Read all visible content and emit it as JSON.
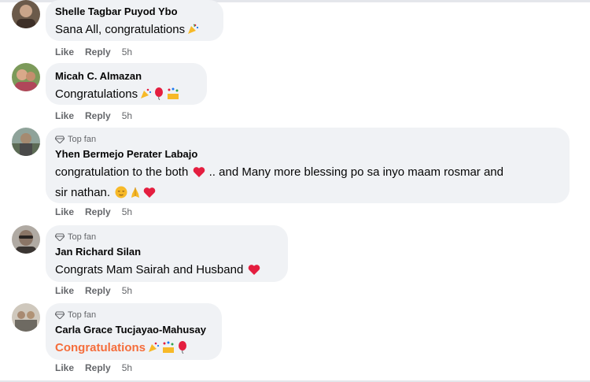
{
  "comments": [
    {
      "author": "Shelle Tagbar Puyod Ybo",
      "top_fan": false,
      "text": "Sana All, congratulations",
      "emojis": [
        "party-popper"
      ],
      "actions": {
        "like": "Like",
        "reply": "Reply",
        "time": "5h"
      }
    },
    {
      "author": "Micah C. Almazan",
      "top_fan": false,
      "text": "Congratulations",
      "emojis": [
        "party-popper",
        "balloon",
        "confetti"
      ],
      "actions": {
        "like": "Like",
        "reply": "Reply",
        "time": "5h"
      }
    },
    {
      "author": "Yhen Bermejo Perater Labajo",
      "top_fan": true,
      "badge": "Top fan",
      "text_line1": "congratulation to the both",
      "text_line1b": ".. and Many more blessing po sa inyo maam rosmar and",
      "text_line2": "sir nathan.",
      "emojis": [
        "heart",
        "relieved-face",
        "praying-hands",
        "heart"
      ],
      "actions": {
        "like": "Like",
        "reply": "Reply",
        "time": "5h"
      }
    },
    {
      "author": "Jan Richard Silan",
      "top_fan": true,
      "badge": "Top fan",
      "text": "Congrats Mam Sairah and Husband",
      "emojis": [
        "heart"
      ],
      "actions": {
        "like": "Like",
        "reply": "Reply",
        "time": "5h"
      }
    },
    {
      "author": "Carla Grace Tucjayao-Mahusay",
      "top_fan": true,
      "badge": "Top fan",
      "text": "Congratulations",
      "emojis": [
        "party-popper",
        "confetti",
        "balloon"
      ],
      "actions": {
        "like": "Like",
        "reply": "Reply",
        "time": "5h"
      }
    }
  ],
  "colors": {
    "bubble": "#f0f2f5",
    "meta_text": "#65676b",
    "highlight_text": "#f56d3b",
    "heart": "#e41e3f"
  }
}
